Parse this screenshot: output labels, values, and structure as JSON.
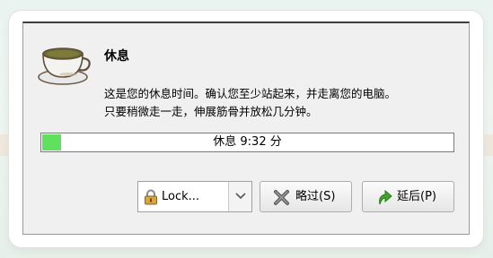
{
  "dialog": {
    "title": "休息",
    "message_line1": "这是您的休息时间。确认您至少站起来，并走离您的电脑。",
    "message_line2": "只要稍微走一走，伸展筋骨并放松几分钟。",
    "progress_label": "休息 9:32 分",
    "progress_fraction": 0.045
  },
  "lock_select": {
    "selected": "Lock...",
    "icon": "lock-icon"
  },
  "buttons": {
    "skip_label": "略过(S)",
    "skip_icon": "x-icon",
    "postpone_label": "延后(P)",
    "postpone_icon": "curved-arrow-icon"
  },
  "colors": {
    "progress_fill": "#5fe15f",
    "skip_icon": "#555555",
    "postpone_icon": "#3fa62a"
  }
}
